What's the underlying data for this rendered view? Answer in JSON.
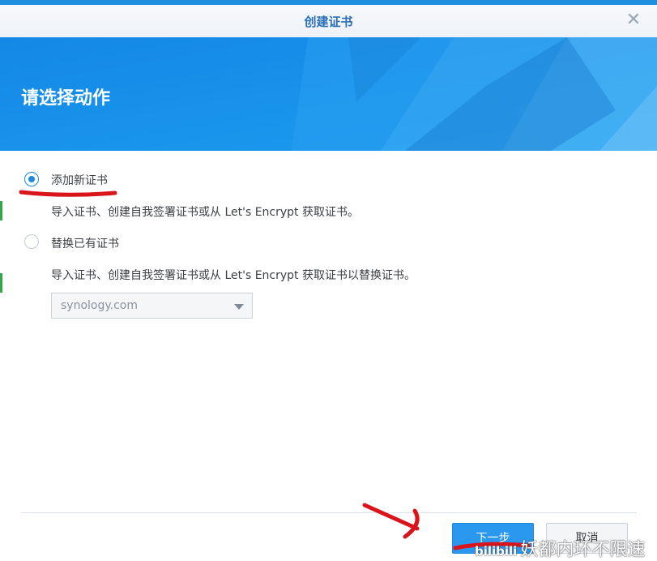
{
  "window": {
    "title": "创建证书",
    "close_icon": "close-icon"
  },
  "banner": {
    "heading": "请选择动作"
  },
  "options": [
    {
      "label": "添加新证书",
      "description": "导入证书、创建自我签署证书或从 Let's Encrypt 获取证书。",
      "selected": true
    },
    {
      "label": "替换已有证书",
      "description": "导入证书、创建自我签署证书或从 Let's Encrypt 获取证书以替换证书。",
      "selected": false
    }
  ],
  "certificate_select": {
    "value": "synology.com",
    "icon": "dropdown-arrow-icon"
  },
  "footer": {
    "next_label": "下一步",
    "cancel_label": "取消"
  },
  "watermark": {
    "text": "妖都内环不限速",
    "logo_text": "bilibili"
  },
  "colors": {
    "accent": "#1a89e0",
    "banner": "#1890e8",
    "annotation": "#d9141b"
  }
}
